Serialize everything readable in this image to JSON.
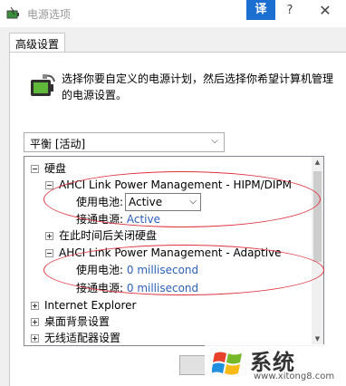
{
  "window": {
    "title": "电源选项",
    "translate_label": "译",
    "help_label": "?",
    "close_label": "✕"
  },
  "tabs": [
    {
      "label": "高级设置"
    }
  ],
  "intro_text": "选择你要自定义的电源计划，然后选择你希望计算机管理的电源设置。",
  "plan_select": {
    "value": "平衡 [活动]"
  },
  "tree": {
    "hard_disk": "硬盘",
    "hipm": {
      "label": "AHCI Link Power Management - HIPM/DIPM",
      "battery_label": "使用电池:",
      "battery_value": "Active",
      "plugged_label": "接通电源:",
      "plugged_value": "Active"
    },
    "turn_off_disk": "在此时间后关闭硬盘",
    "adaptive": {
      "label": "AHCI Link Power Management - Adaptive",
      "battery_label": "使用电池:",
      "battery_value": "0 millisecond",
      "plugged_label": "接通电源:",
      "plugged_value": "0 millisecond"
    },
    "ie": "Internet Explorer",
    "desktop_bg": "桌面背景设置",
    "wireless": "无线适配器设置"
  },
  "watermark": {
    "text": "系统",
    "url": "www.xitong8.com"
  },
  "colors": {
    "accent": "#1a6fd1",
    "highlight": "#e0323e",
    "link": "#2b5fb8"
  }
}
